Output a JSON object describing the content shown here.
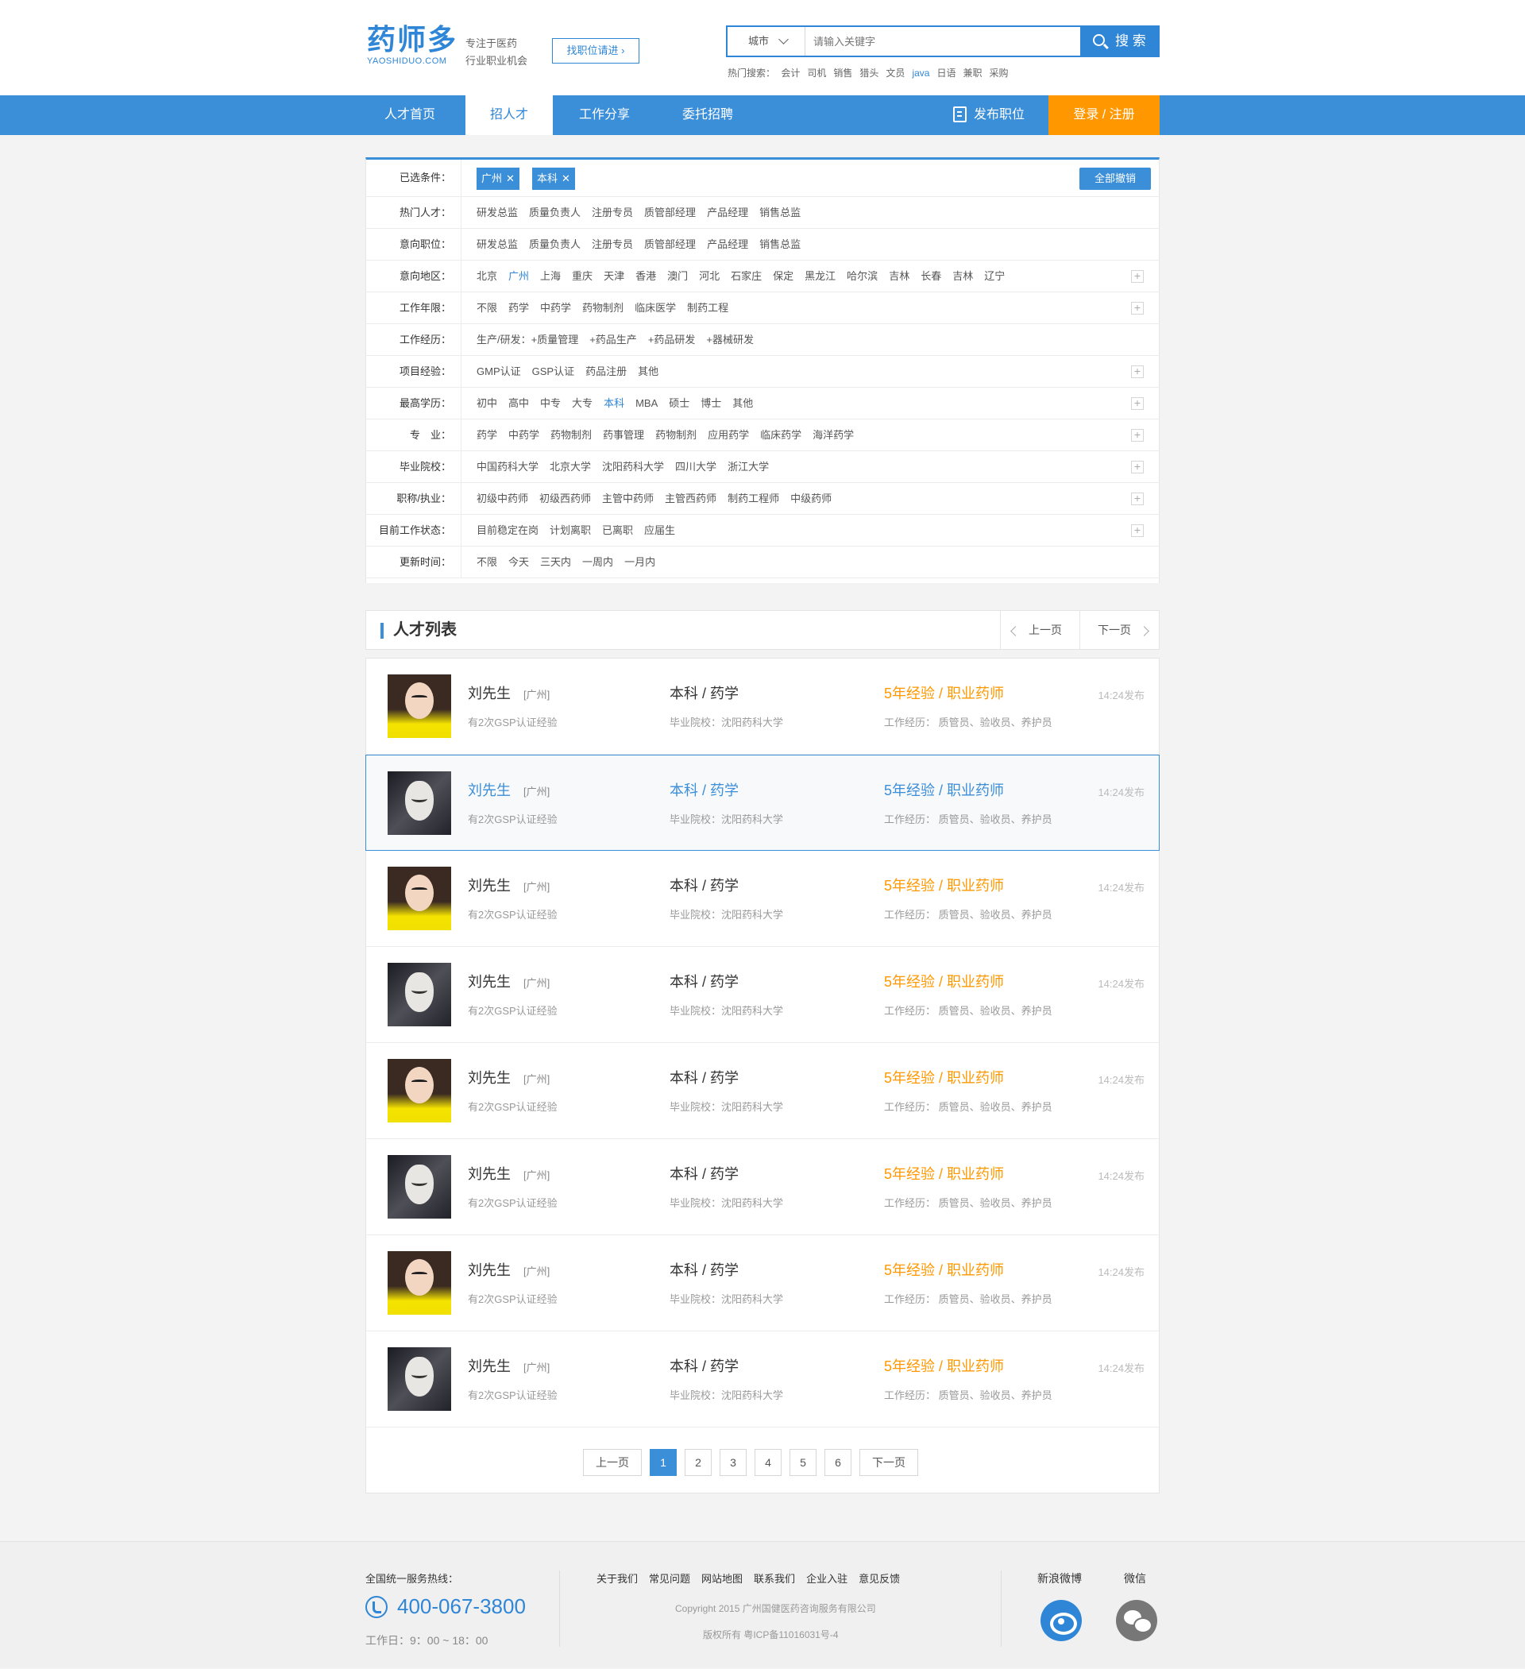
{
  "header": {
    "logo_cn": "药师多",
    "logo_en": "YAOSHIDUO.COM",
    "slogan_line1": "专注于医药",
    "slogan_line2": "行业职业机会",
    "find_job": "找职位请进",
    "city_select": "城市",
    "search_placeholder": "请输入关键字",
    "search_button": "搜 索",
    "hot_label": "热门搜索：",
    "hot_terms": [
      "会计",
      "司机",
      "销售",
      "猎头",
      "文员",
      "java",
      "日语",
      "兼职",
      "采购"
    ]
  },
  "nav": {
    "items": [
      "人才首页",
      "招人才",
      "工作分享",
      "委托招聘"
    ],
    "active_index": 1,
    "post_job": "发布职位",
    "login": "登录 / 注册"
  },
  "filter": {
    "selected_label": "已选条件：",
    "selected_tags": [
      "广州",
      "本科"
    ],
    "clear_all": "全部撤销",
    "rows": [
      {
        "label": "热门人才：",
        "options": [
          "研发总监",
          "质量负责人",
          "注册专员",
          "质管部经理",
          "产品经理",
          "销售总监"
        ],
        "selected": -1,
        "expand": false
      },
      {
        "label": "意向职位：",
        "options": [
          "研发总监",
          "质量负责人",
          "注册专员",
          "质管部经理",
          "产品经理",
          "销售总监"
        ],
        "selected": -1,
        "expand": false
      },
      {
        "label": "意向地区：",
        "options": [
          "北京",
          "广州",
          "上海",
          "重庆",
          "天津",
          "香港",
          "澳门",
          "河北",
          "石家庄",
          "保定",
          "黑龙江",
          "哈尔滨",
          "吉林",
          "长春",
          "吉林",
          "辽宁"
        ],
        "selected": 1,
        "expand": true
      },
      {
        "label": "工作年限：",
        "options": [
          "不限",
          "药学",
          "中药学",
          "药物制剂",
          "临床医学",
          "制药工程"
        ],
        "selected": -1,
        "expand": true
      },
      {
        "label": "工作经历：",
        "options": [
          "生产/研发：+质量管理",
          "+药品生产",
          "+药品研发",
          "+器械研发"
        ],
        "selected": -1,
        "expand": false
      },
      {
        "label": "项目经验：",
        "options": [
          "GMP认证",
          "GSP认证",
          "药品注册",
          "其他"
        ],
        "selected": -1,
        "expand": true
      },
      {
        "label": "最高学历：",
        "options": [
          "初中",
          "高中",
          "中专",
          "大专",
          "本科",
          "MBA",
          "硕士",
          "博士",
          "其他"
        ],
        "selected": 4,
        "expand": true
      },
      {
        "label": "专　业：",
        "options": [
          "药学",
          "中药学",
          "药物制剂",
          "药事管理",
          "药物制剂",
          "应用药学",
          "临床药学",
          "海洋药学"
        ],
        "selected": -1,
        "expand": true
      },
      {
        "label": "毕业院校：",
        "options": [
          "中国药科大学",
          "北京大学",
          "沈阳药科大学",
          "四川大学",
          "浙江大学"
        ],
        "selected": -1,
        "expand": true
      },
      {
        "label": "职称/执业：",
        "options": [
          "初级中药师",
          "初级西药师",
          "主管中药师",
          "主管西药师",
          "制药工程师",
          "中级药师"
        ],
        "selected": -1,
        "expand": true
      },
      {
        "label": "目前工作状态：",
        "options": [
          "目前稳定在岗",
          "计划离职",
          "已离职",
          "应届生"
        ],
        "selected": -1,
        "expand": true
      },
      {
        "label": "更新时间：",
        "options": [
          "不限",
          "今天",
          "三天内",
          "一周内",
          "一月内"
        ],
        "selected": -1,
        "expand": false
      }
    ]
  },
  "list": {
    "title": "人才列表",
    "prev": "上一页",
    "next": "下一页",
    "candidates": [
      {
        "name": "刘先生",
        "loc": "[广州]",
        "gsp": "有2次GSP认证经验",
        "edu": "本科 / 药学",
        "school": "毕业院校：沈阳药科大学",
        "exp": "5年经验 / 职业药师",
        "hist": "工作经历：  质管员、验收员、养护员",
        "time": "14:24发布",
        "avatar": "girl",
        "active": false
      },
      {
        "name": "刘先生",
        "loc": "[广州]",
        "gsp": "有2次GSP认证经验",
        "edu": "本科 / 药学",
        "school": "毕业院校：沈阳药科大学",
        "exp": "5年经验 / 职业药师",
        "hist": "工作经历：  质管员、验收员、养护员",
        "time": "14:24发布",
        "avatar": "mask",
        "active": true
      },
      {
        "name": "刘先生",
        "loc": "[广州]",
        "gsp": "有2次GSP认证经验",
        "edu": "本科 / 药学",
        "school": "毕业院校：沈阳药科大学",
        "exp": "5年经验 / 职业药师",
        "hist": "工作经历：  质管员、验收员、养护员",
        "time": "14:24发布",
        "avatar": "girl",
        "active": false
      },
      {
        "name": "刘先生",
        "loc": "[广州]",
        "gsp": "有2次GSP认证经验",
        "edu": "本科 / 药学",
        "school": "毕业院校：沈阳药科大学",
        "exp": "5年经验 / 职业药师",
        "hist": "工作经历：  质管员、验收员、养护员",
        "time": "14:24发布",
        "avatar": "mask",
        "active": false
      },
      {
        "name": "刘先生",
        "loc": "[广州]",
        "gsp": "有2次GSP认证经验",
        "edu": "本科 / 药学",
        "school": "毕业院校：沈阳药科大学",
        "exp": "5年经验 / 职业药师",
        "hist": "工作经历：  质管员、验收员、养护员",
        "time": "14:24发布",
        "avatar": "girl",
        "active": false
      },
      {
        "name": "刘先生",
        "loc": "[广州]",
        "gsp": "有2次GSP认证经验",
        "edu": "本科 / 药学",
        "school": "毕业院校：沈阳药科大学",
        "exp": "5年经验 / 职业药师",
        "hist": "工作经历：  质管员、验收员、养护员",
        "time": "14:24发布",
        "avatar": "mask",
        "active": false
      },
      {
        "name": "刘先生",
        "loc": "[广州]",
        "gsp": "有2次GSP认证经验",
        "edu": "本科 / 药学",
        "school": "毕业院校：沈阳药科大学",
        "exp": "5年经验 / 职业药师",
        "hist": "工作经历：  质管员、验收员、养护员",
        "time": "14:24发布",
        "avatar": "girl",
        "active": false
      },
      {
        "name": "刘先生",
        "loc": "[广州]",
        "gsp": "有2次GSP认证经验",
        "edu": "本科 / 药学",
        "school": "毕业院校：沈阳药科大学",
        "exp": "5年经验 / 职业药师",
        "hist": "工作经历：  质管员、验收员、养护员",
        "time": "14:24发布",
        "avatar": "mask",
        "active": false
      }
    ],
    "pagination": {
      "prev": "上一页",
      "pages": [
        "1",
        "2",
        "3",
        "4",
        "5",
        "6"
      ],
      "current": 0,
      "next": "下一页"
    }
  },
  "footer": {
    "hotline_label": "全国统一服务热线：",
    "phone": "400-067-3800",
    "worktime": "工作日：9：00 ~ 18：00",
    "links": [
      "关于我们",
      "常见问题",
      "网站地图",
      "联系我们",
      "企业入驻",
      "意见反馈"
    ],
    "copyright": "Copyright 2015 广州国健医药咨询服务有限公司",
    "icp": "版权所有   粤ICP备11016031号-4",
    "weibo": "新浪微博",
    "wechat": "微信"
  },
  "colors": {
    "primary": "#3b8ed8",
    "accent": "#ff9800"
  }
}
